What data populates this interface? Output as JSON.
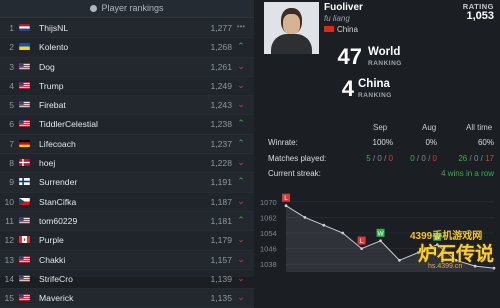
{
  "rankings_panel": {
    "header": "Player rankings",
    "rows": [
      {
        "rank": "1",
        "flag": "nl",
        "name": "ThijsNL",
        "rating": "1,277",
        "trend": "same"
      },
      {
        "rank": "2",
        "flag": "ua",
        "name": "Kolento",
        "rating": "1,268",
        "trend": "up"
      },
      {
        "rank": "3",
        "flag": "us",
        "name": "Dog",
        "rating": "1,261",
        "trend": "down"
      },
      {
        "rank": "4",
        "flag": "us",
        "name": "Trump",
        "rating": "1,249",
        "trend": "down"
      },
      {
        "rank": "5",
        "flag": "us",
        "name": "Firebat",
        "rating": "1,243",
        "trend": "down"
      },
      {
        "rank": "6",
        "flag": "us",
        "name": "TiddlerCelestial",
        "rating": "1,238",
        "trend": "up"
      },
      {
        "rank": "7",
        "flag": "de",
        "name": "Lifecoach",
        "rating": "1,237",
        "trend": "up"
      },
      {
        "rank": "8",
        "flag": "dk",
        "name": "hoej",
        "rating": "1,228",
        "trend": "down"
      },
      {
        "rank": "9",
        "flag": "fi",
        "name": "Surrender",
        "rating": "1,191",
        "trend": "up"
      },
      {
        "rank": "10",
        "flag": "cz",
        "name": "StanCifka",
        "rating": "1,187",
        "trend": "down"
      },
      {
        "rank": "11",
        "flag": "us",
        "name": "tom60229",
        "rating": "1,181",
        "trend": "up"
      },
      {
        "rank": "12",
        "flag": "ca",
        "name": "Purple",
        "rating": "1,179",
        "trend": "down"
      },
      {
        "rank": "13",
        "flag": "us",
        "name": "Chakki",
        "rating": "1,157",
        "trend": "down"
      },
      {
        "rank": "14",
        "flag": "us",
        "name": "StrifeCro",
        "rating": "1,139",
        "trend": "down"
      },
      {
        "rank": "15",
        "flag": "us",
        "name": "Maverick",
        "rating": "1,135",
        "trend": "down"
      }
    ]
  },
  "profile": {
    "name": "Fuoliver",
    "real_name": "fu liang",
    "country": "China",
    "rating_label": "RATING",
    "rating_value": "1,053",
    "world_rank": "47",
    "world_label": "World",
    "world_sub": "RANKING",
    "country_rank": "4",
    "country_label": "China",
    "country_sub": "RANKING"
  },
  "stats": {
    "columns": [
      "Sep",
      "Aug",
      "All time"
    ],
    "winrate_label": "Winrate:",
    "winrate": [
      "100%",
      "0%",
      "60%"
    ],
    "matches_label": "Matches played:",
    "matches": [
      {
        "w": "5",
        "sep": "/",
        "d": "0",
        "l": "0"
      },
      {
        "w": "0",
        "sep": "/",
        "d": "0",
        "l": "0"
      },
      {
        "w": "26",
        "sep": "/",
        "d": "0",
        "l": "17"
      }
    ],
    "streak_label": "Current streak:",
    "streak_value": "4 wins in a row"
  },
  "chart_data": {
    "type": "line",
    "y_ticks": [
      "1070",
      "1062",
      "1054",
      "1046",
      "1038"
    ],
    "ylim": [
      1034,
      1074
    ],
    "values": [
      1068,
      1062,
      1058,
      1054,
      1046,
      1050,
      1040,
      1044,
      1048,
      1040,
      1037,
      1036
    ],
    "markers": [
      {
        "index": 0,
        "text": "L",
        "color": "#d83b3b"
      },
      {
        "index": 4,
        "text": "L",
        "color": "#d83b3b"
      },
      {
        "index": 5,
        "text": "W",
        "color": "#36b04a"
      },
      {
        "index": 8,
        "text": "W",
        "color": "#36b04a"
      }
    ]
  },
  "watermark": {
    "line1": "4399手机游戏网",
    "line2": "炉石传说",
    "line3": "hs.4399.cn"
  },
  "colors": {
    "win": "#36b04a",
    "loss": "#d83b3b",
    "panel": "#20252b"
  }
}
